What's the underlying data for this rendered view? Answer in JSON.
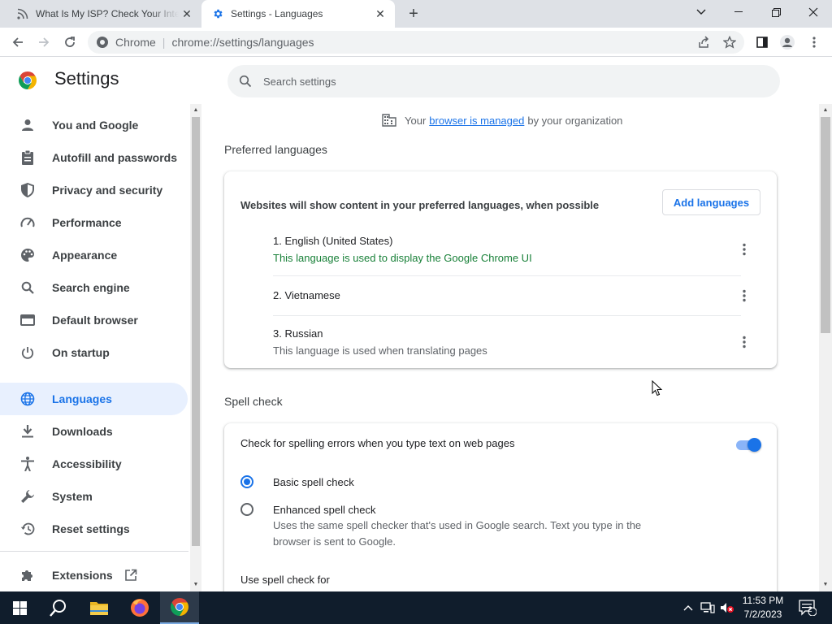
{
  "tabs": [
    {
      "title": "What Is My ISP? Check Your Internet",
      "active": false
    },
    {
      "title": "Settings - Languages",
      "active": true
    }
  ],
  "omnibox": {
    "chip": "Chrome",
    "url": "chrome://settings/languages"
  },
  "settings": {
    "title": "Settings",
    "search_placeholder": "Search settings"
  },
  "sidebar": {
    "items": [
      {
        "label": "You and Google",
        "icon": "person-icon"
      },
      {
        "label": "Autofill and passwords",
        "icon": "clipboard-icon"
      },
      {
        "label": "Privacy and security",
        "icon": "shield-icon"
      },
      {
        "label": "Performance",
        "icon": "speedometer-icon"
      },
      {
        "label": "Appearance",
        "icon": "palette-icon"
      },
      {
        "label": "Search engine",
        "icon": "search-icon"
      },
      {
        "label": "Default browser",
        "icon": "browser-icon"
      },
      {
        "label": "On startup",
        "icon": "power-icon"
      },
      {
        "label": "Languages",
        "icon": "globe-icon",
        "active": true
      },
      {
        "label": "Downloads",
        "icon": "download-icon"
      },
      {
        "label": "Accessibility",
        "icon": "accessibility-icon"
      },
      {
        "label": "System",
        "icon": "wrench-icon"
      },
      {
        "label": "Reset settings",
        "icon": "history-icon"
      }
    ],
    "extensions": {
      "label": "Extensions"
    }
  },
  "managed": {
    "prefix": "Your",
    "link": "browser is managed",
    "suffix": "by your organization"
  },
  "preferred": {
    "section_title": "Preferred languages",
    "header": "Websites will show content in your preferred languages, when possible",
    "add_button": "Add languages",
    "languages": [
      {
        "name": "1. English (United States)",
        "note": "This language is used to display the Google Chrome UI",
        "note_style": "green"
      },
      {
        "name": "2. Vietnamese",
        "note": ""
      },
      {
        "name": "3. Russian",
        "note": "This language is used when translating pages",
        "note_style": "grey"
      }
    ]
  },
  "spellcheck": {
    "section_title": "Spell check",
    "toggle_label": "Check for spelling errors when you type text on web pages",
    "toggle_on": true,
    "basic_label": "Basic spell check",
    "enhanced_label": "Enhanced spell check",
    "enhanced_desc": "Uses the same spell checker that's used in Google search. Text you type in the browser is sent to Google.",
    "use_for_label": "Use spell check for",
    "selected": "basic"
  },
  "taskbar": {
    "time": "11:53 PM",
    "date": "7/2/2023",
    "notification_count": "2"
  },
  "colors": {
    "accent": "#1a73e8",
    "green": "#188038",
    "taskbar": "#101d2c"
  }
}
